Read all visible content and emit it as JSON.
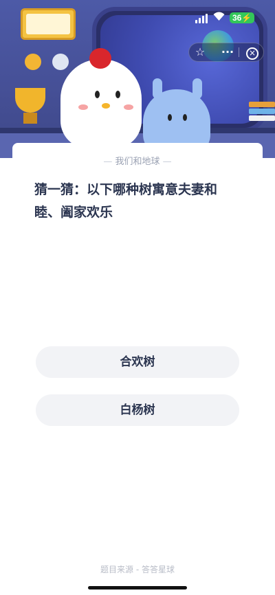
{
  "status_bar": {
    "battery": "36"
  },
  "card": {
    "category": "我们和地球",
    "question": "猜一猜：以下哪种树寓意夫妻和睦、阖家欢乐",
    "options": [
      {
        "label": "合欢树"
      },
      {
        "label": "白杨树"
      }
    ],
    "source": "题目来源 - 答答星球"
  },
  "icons": {
    "capsule": [
      "star-icon",
      "more-icon",
      "close-icon"
    ]
  },
  "colors": {
    "header_bg": "#4d5aa7",
    "option_bg": "#f2f3f6",
    "question_text": "#2b3550",
    "battery": "#33c75a"
  }
}
